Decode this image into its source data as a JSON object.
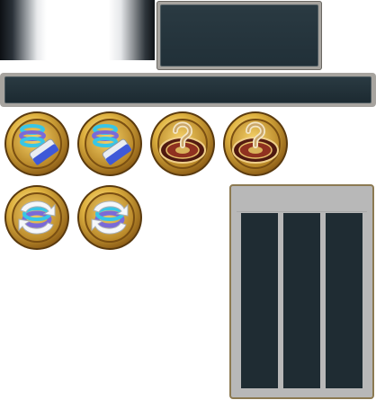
{
  "colors": {
    "panel_dark": "#213038",
    "panel_frame": "#a7a49f",
    "gold": "#c89a2a",
    "table_bg": "#b8b8b8",
    "table_col": "#1f2c33"
  },
  "buttons": [
    {
      "icon": "spring-eraser-icon"
    },
    {
      "icon": "spring-eraser-icon"
    },
    {
      "icon": "roulette-question-icon"
    },
    {
      "icon": "roulette-question-icon"
    },
    {
      "icon": "swap-arrows-icon"
    },
    {
      "icon": "swap-arrows-icon"
    }
  ],
  "table": {
    "columns": 3
  }
}
